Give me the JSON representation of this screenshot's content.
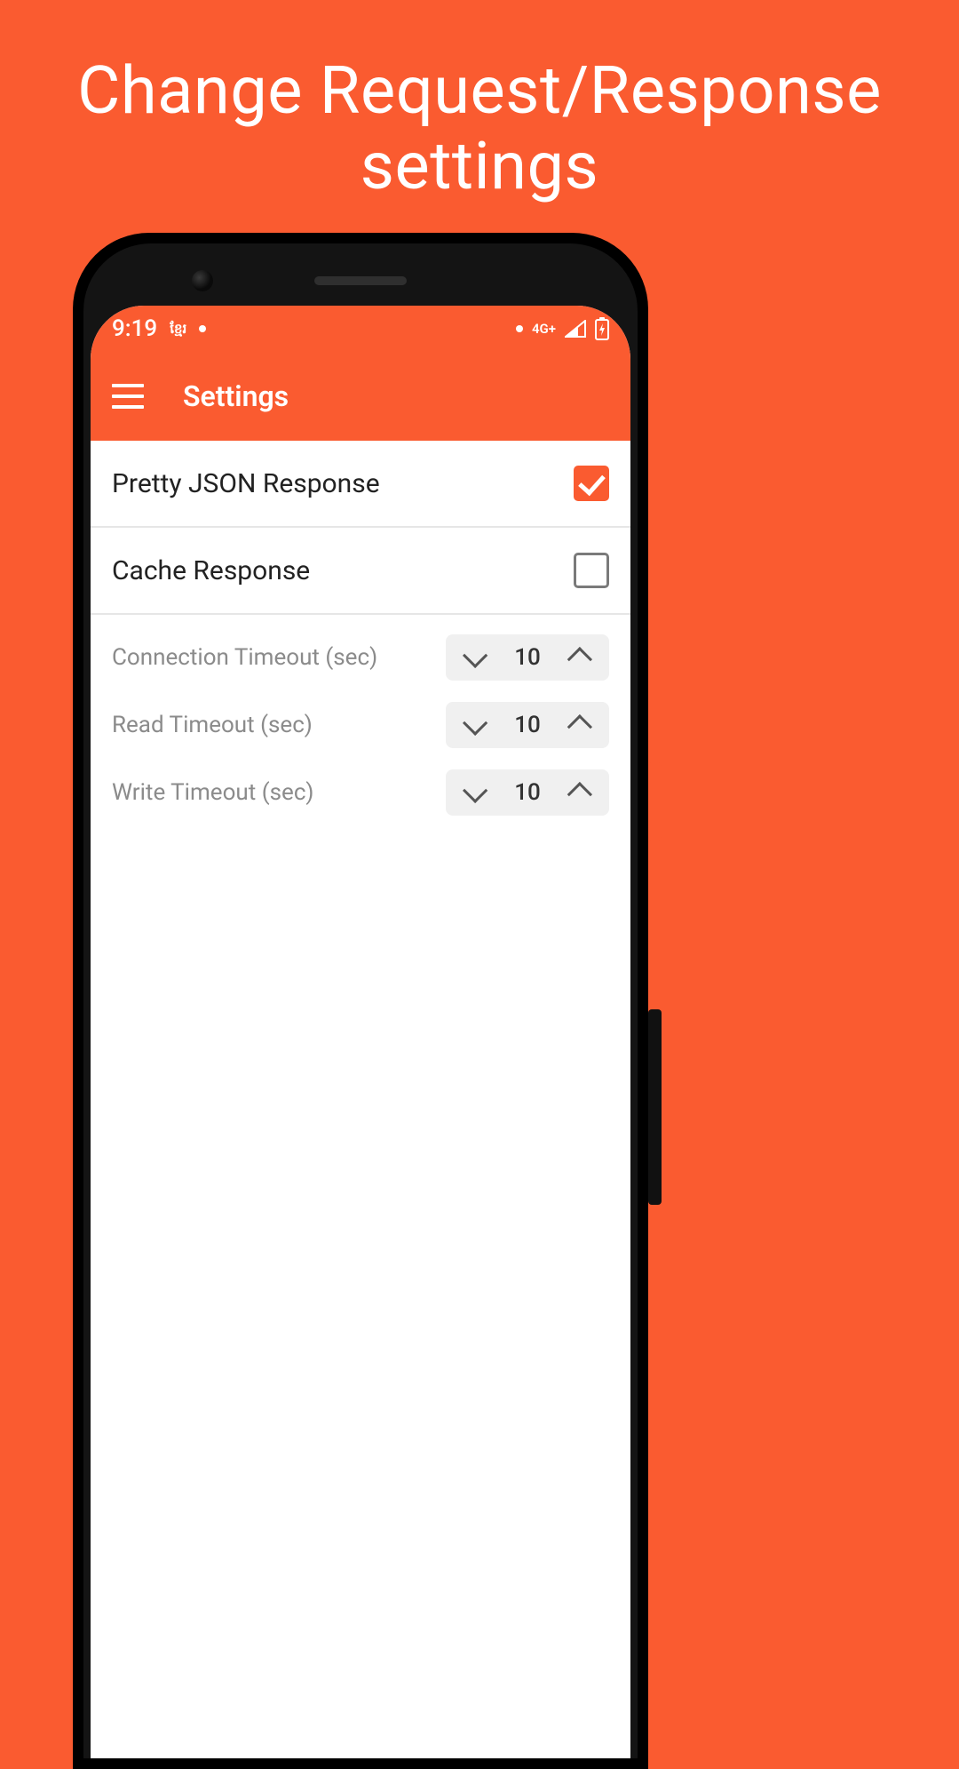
{
  "promo": {
    "headline_line1": "Change Request/Response",
    "headline_line2": "settings"
  },
  "statusbar": {
    "time": "9:19",
    "carrier_badge": "ខ្មែរ",
    "network_label": "4G+"
  },
  "appbar": {
    "title": "Settings"
  },
  "settings": {
    "pretty_json": {
      "label": "Pretty JSON Response",
      "checked": true
    },
    "cache_response": {
      "label": "Cache Response",
      "checked": false
    },
    "timeouts": {
      "connection": {
        "label": "Connection Timeout (sec)",
        "value": "10"
      },
      "read": {
        "label": "Read Timeout (sec)",
        "value": "10"
      },
      "write": {
        "label": "Write Timeout (sec)",
        "value": "10"
      }
    }
  }
}
